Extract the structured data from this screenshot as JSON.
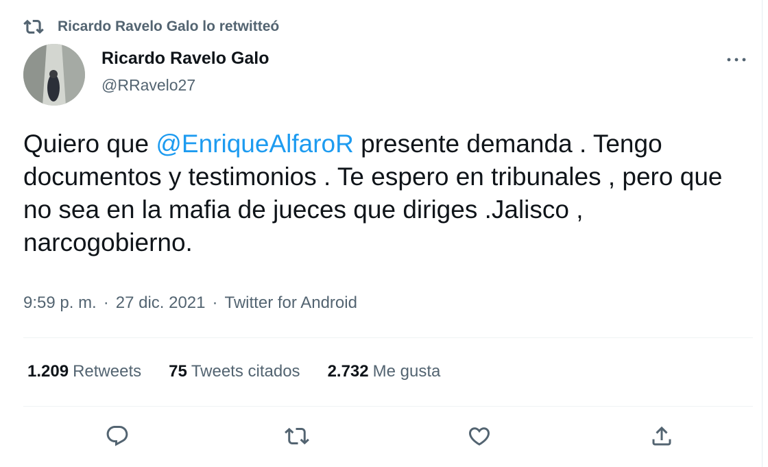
{
  "retweet_context": {
    "text": "Ricardo Ravelo Galo lo retwitteó",
    "icon": "retweet-icon"
  },
  "author": {
    "name": "Ricardo Ravelo Galo",
    "handle": "@RRavelo27",
    "avatar": "avatar-photo"
  },
  "more_icon": "more-dots-icon",
  "tweet": {
    "text_before": "Quiero que ",
    "mention": "@EnriqueAlfaroR",
    "text_after": " presente demanda . Tengo documentos y testimonios . Te espero en tribunales , pero que no sea en la mafia de jueces que diriges .Jalisco , narcogobierno."
  },
  "meta": {
    "time": "9:59 p. m.",
    "separator": "·",
    "date": "27 dic. 2021",
    "source": "Twitter for Android"
  },
  "stats": {
    "retweets": {
      "count": "1.209",
      "label": "Retweets"
    },
    "quotes": {
      "count": "75",
      "label": "Tweets citados"
    },
    "likes": {
      "count": "2.732",
      "label": "Me gusta"
    }
  },
  "actions": [
    "reply-icon",
    "retweet-icon",
    "like-icon",
    "share-icon"
  ],
  "colors": {
    "accent": "#1d9bf0",
    "secondary_text": "#536471",
    "primary_text": "#0f1419",
    "divider": "#eff3f4"
  }
}
